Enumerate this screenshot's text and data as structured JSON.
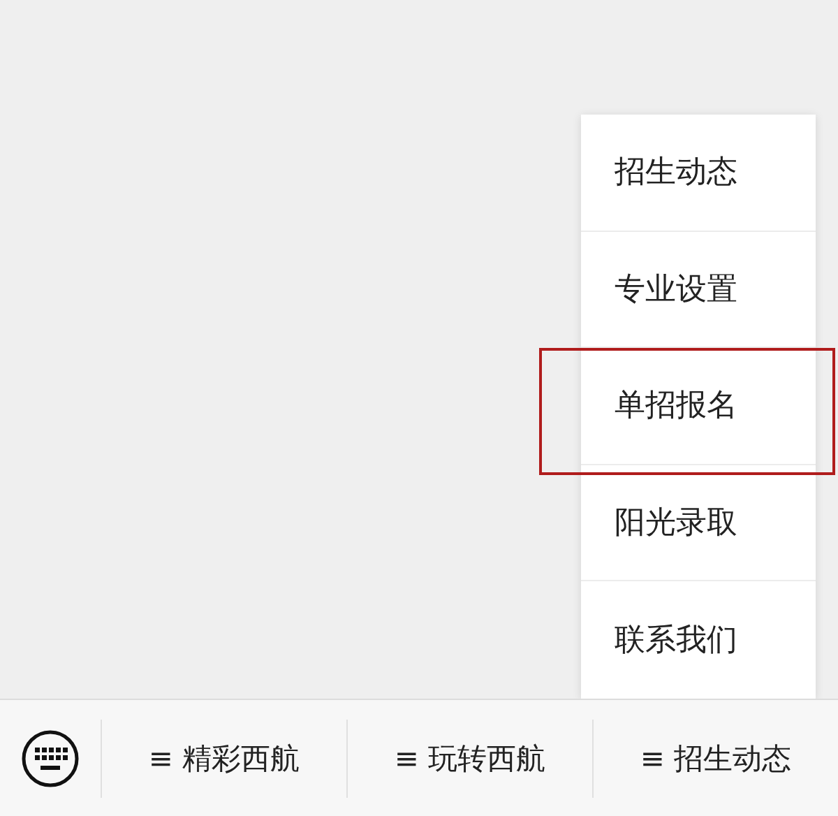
{
  "popup_menu": {
    "items": [
      {
        "label": "招生动态",
        "highlighted": false
      },
      {
        "label": "专业设置",
        "highlighted": false
      },
      {
        "label": "单招报名",
        "highlighted": true
      },
      {
        "label": "阳光录取",
        "highlighted": false
      },
      {
        "label": "联系我们",
        "highlighted": false
      }
    ]
  },
  "bottom_menu": {
    "items": [
      "≡ 精彩西航",
      "≡ 玩转西航",
      "≡ 招生动态"
    ]
  }
}
